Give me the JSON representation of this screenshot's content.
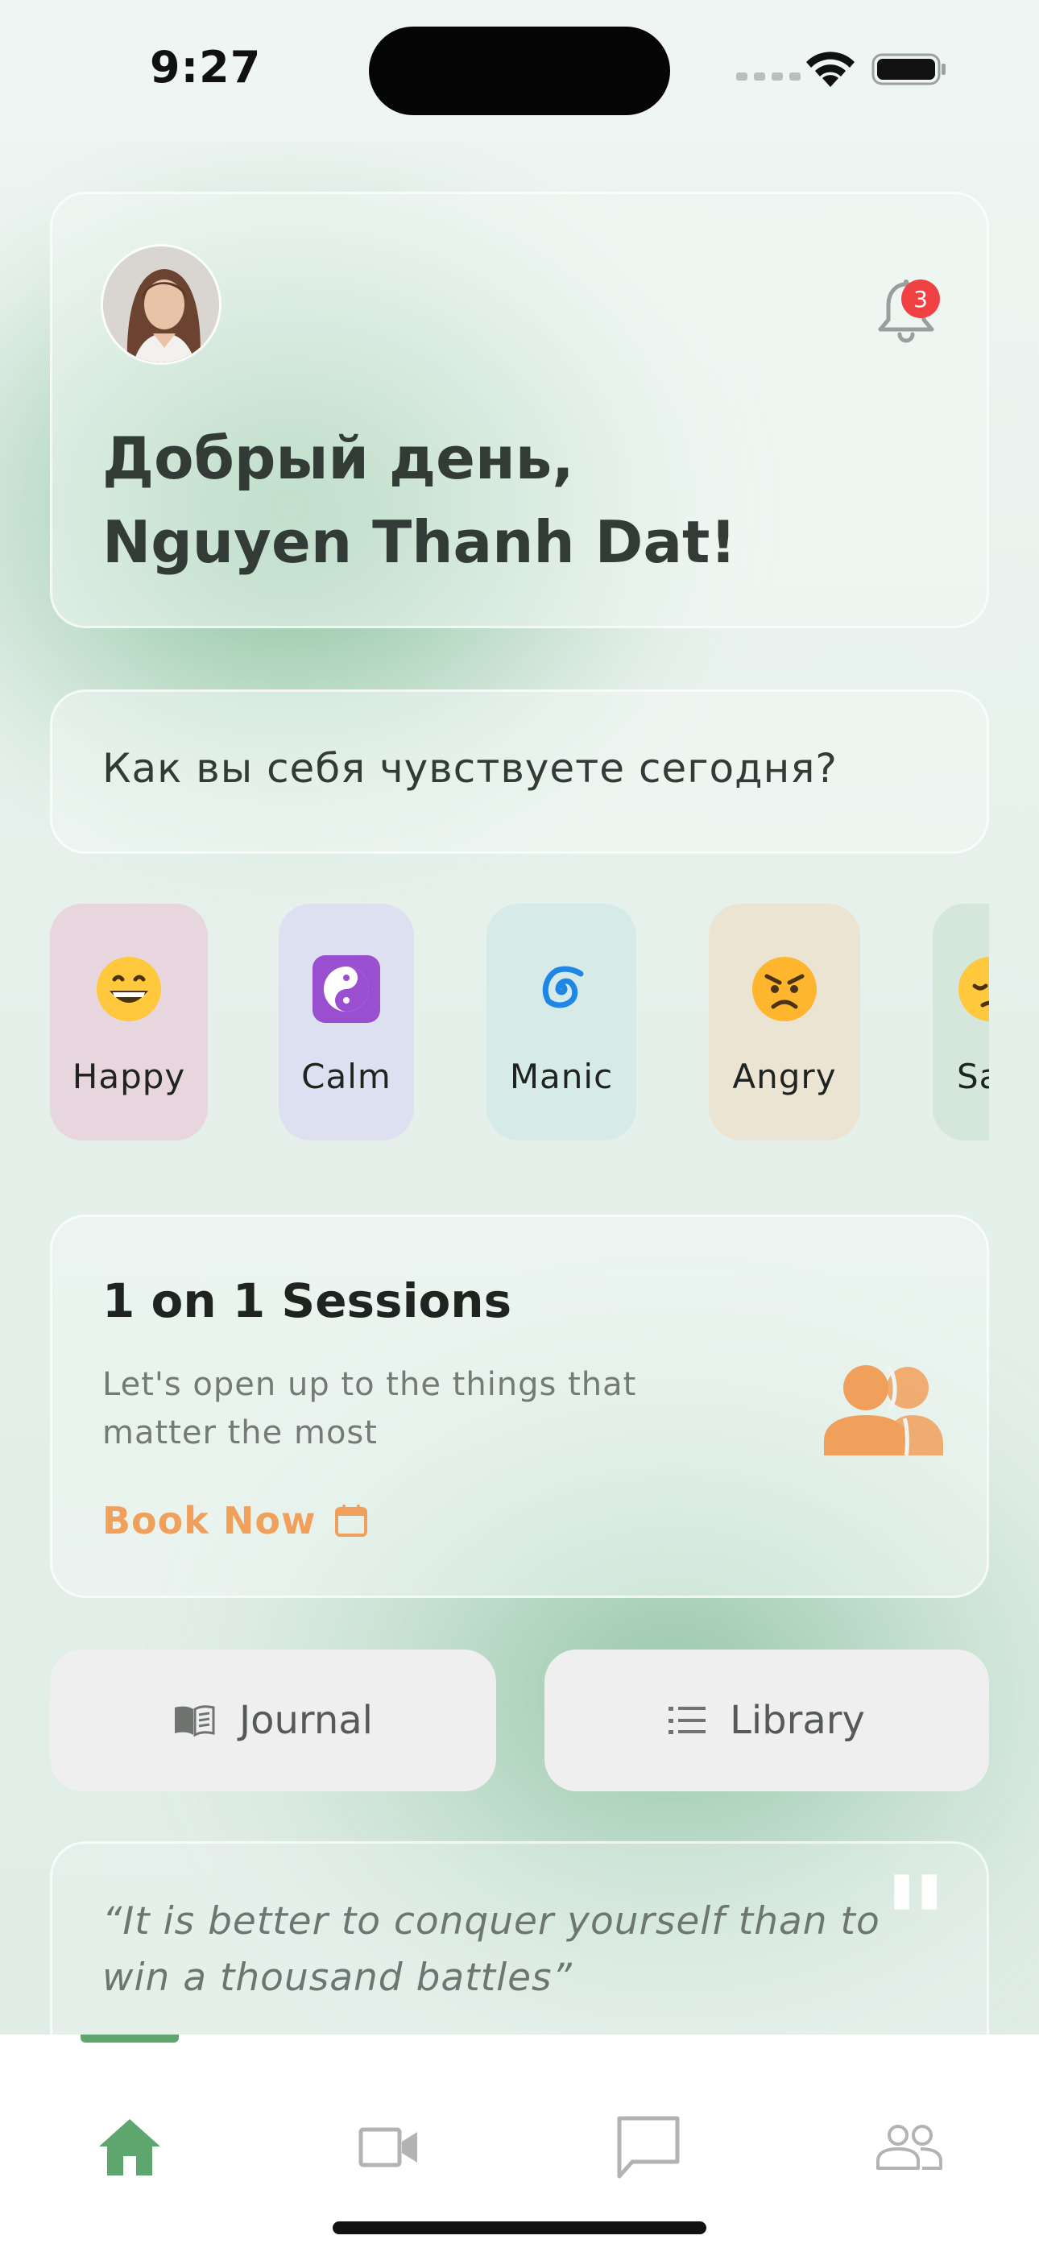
{
  "status_bar": {
    "time": "9:27"
  },
  "greeting": {
    "line1": "Добрый день,",
    "line2": "Nguyen Thanh Dat!",
    "notification_count": "3",
    "avatar_icon": "user-avatar",
    "bell_icon": "bell-icon"
  },
  "mood_question": "Как вы себя чувствуете сегодня?",
  "moods": [
    {
      "label": "Happy",
      "icon": "grinning-face-icon",
      "bg": "#e8d6de"
    },
    {
      "label": "Calm",
      "icon": "yin-yang-icon",
      "bg": "#dde0f1"
    },
    {
      "label": "Manic",
      "icon": "cyclone-icon",
      "bg": "#d6ebe8"
    },
    {
      "label": "Angry",
      "icon": "angry-face-icon",
      "bg": "#ece4d2"
    },
    {
      "label": "Sa",
      "icon": "pensive-face-icon",
      "bg": "#d5e7da"
    }
  ],
  "session": {
    "title": "1 on 1 Sessions",
    "subtitle": "Let's open up to the things that matter the most",
    "cta": "Book Now",
    "cta_color": "#f0a05b"
  },
  "quick_actions": {
    "journal": "Journal",
    "library": "Library"
  },
  "quote": {
    "text": "“It is better to conquer yourself than to win a thousand battles”",
    "mark": "\""
  },
  "tabbar": {
    "active": "home",
    "active_color": "#5ea66e",
    "inactive_color": "#b3b3b3",
    "tabs": [
      "home-icon",
      "video-icon",
      "chat-icon",
      "community-icon"
    ]
  }
}
